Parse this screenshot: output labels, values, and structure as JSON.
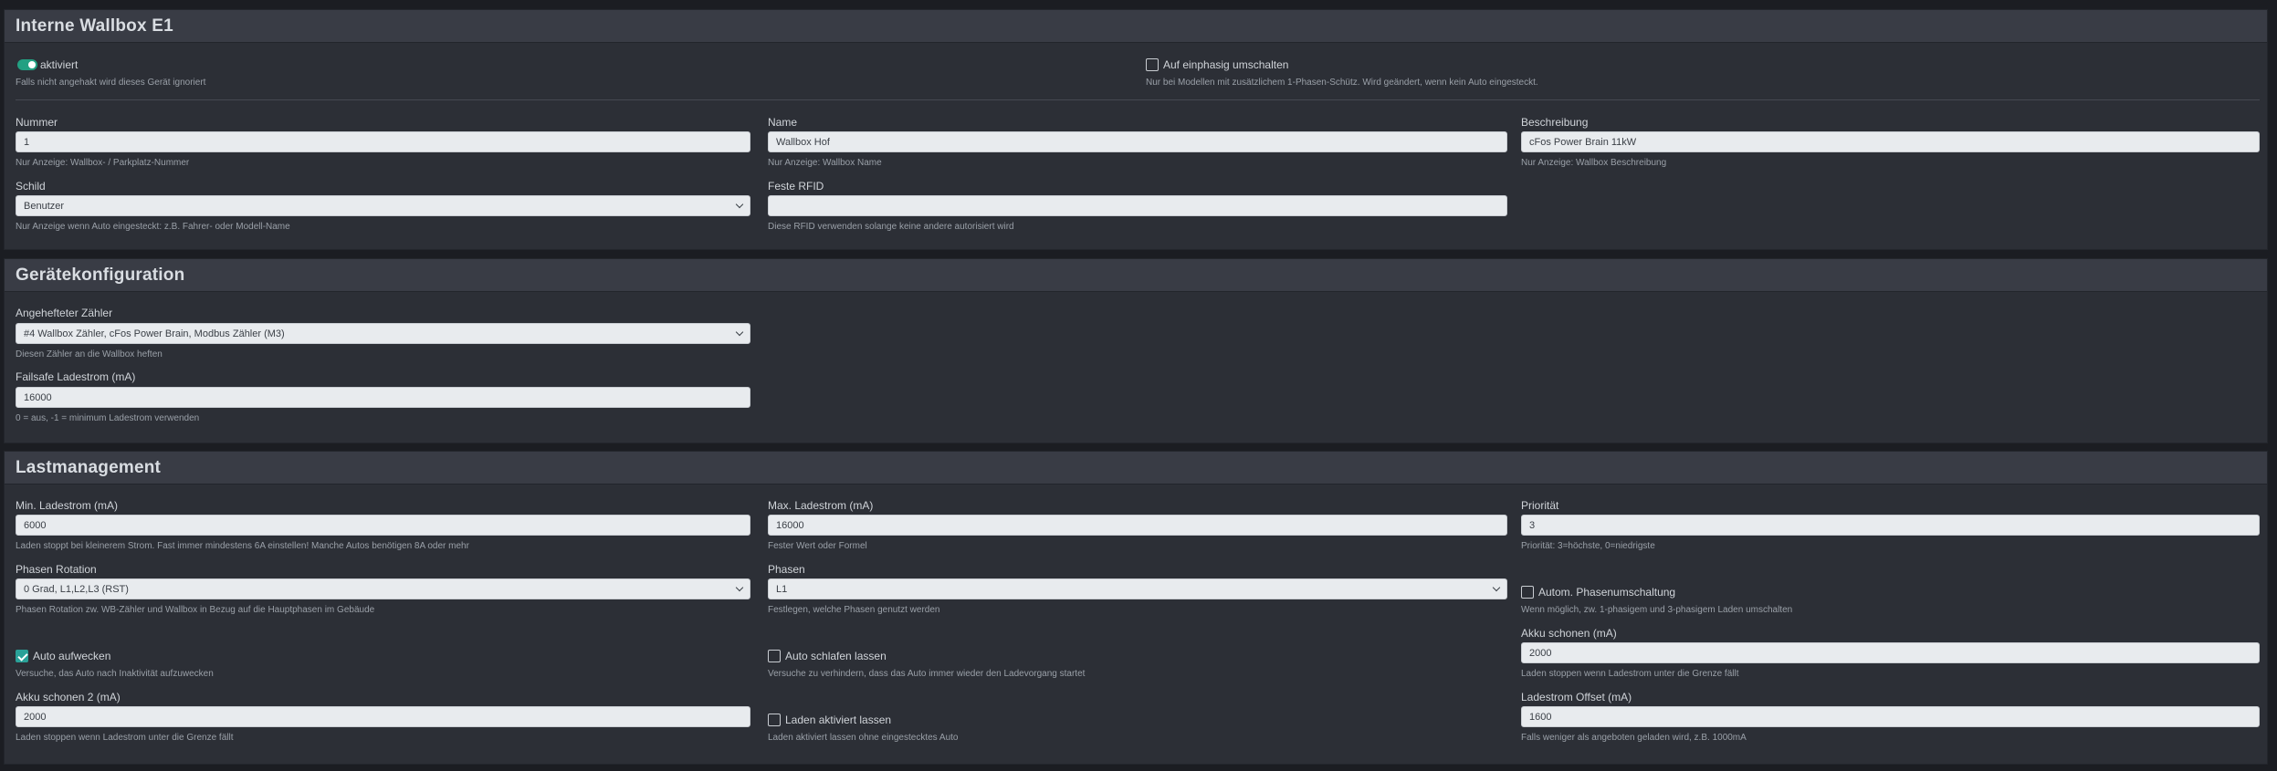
{
  "sections": {
    "wallbox": {
      "title": "Interne Wallbox E1",
      "active_label": "aktiviert",
      "active_help": "Falls nicht angehakt wird dieses Gerät ignoriert",
      "active_checked": true,
      "singlephase_label": "Auf einphasig umschalten",
      "singlephase_help": "Nur bei Modellen mit zusätzlichem 1-Phasen-Schütz. Wird geändert, wenn kein Auto eingesteckt.",
      "number": {
        "label": "Nummer",
        "value": "1",
        "help": "Nur Anzeige: Wallbox- / Parkplatz-Nummer"
      },
      "name": {
        "label": "Name",
        "value": "Wallbox Hof",
        "help": "Nur Anzeige: Wallbox Name"
      },
      "description": {
        "label": "Beschreibung",
        "value": "cFos Power Brain 11kW",
        "help": "Nur Anzeige: Wallbox Beschreibung"
      },
      "sign": {
        "label": "Schild",
        "value": "Benutzer",
        "help": "Nur Anzeige wenn Auto eingesteckt: z.B. Fahrer- oder Modell-Name"
      },
      "rfid": {
        "label": "Feste RFID",
        "value": "",
        "help": "Diese RFID verwenden solange keine andere autorisiert wird"
      }
    },
    "device": {
      "title": "Gerätekonfiguration",
      "meter": {
        "label": "Angehefteter Zähler",
        "value": "#4 Wallbox Zähler, cFos Power Brain, Modbus Zähler (M3)",
        "help": "Diesen Zähler an die Wallbox heften"
      },
      "failsafe": {
        "label": "Failsafe Ladestrom (mA)",
        "value": "16000",
        "help": "0 = aus, -1 = minimum Ladestrom verwenden"
      }
    },
    "load": {
      "title": "Lastmanagement",
      "min_current": {
        "label": "Min. Ladestrom (mA)",
        "value": "6000",
        "help": "Laden stoppt bei kleinerem Strom. Fast immer mindestens 6A einstellen! Manche Autos benötigen 8A oder mehr"
      },
      "max_current": {
        "label": "Max. Ladestrom (mA)",
        "value": "16000",
        "help": "Fester Wert oder Formel"
      },
      "priority": {
        "label": "Priorität",
        "value": "3",
        "help": "Priorität: 3=höchste, 0=niedrigste"
      },
      "phase_rotation": {
        "label": "Phasen Rotation",
        "value": "0 Grad, L1,L2,L3 (RST)",
        "help": "Phasen Rotation zw. WB-Zähler und Wallbox in Bezug auf die Hauptphasen im Gebäude"
      },
      "phases": {
        "label": "Phasen",
        "value": "L1",
        "help": "Festlegen, welche Phasen genutzt werden"
      },
      "auto_phase": {
        "label": "Autom. Phasenumschaltung",
        "checked": false,
        "help": "Wenn möglich, zw. 1-phasigem und 3-phasigem Laden umschalten"
      },
      "battery_save": {
        "label": "Akku schonen (mA)",
        "value": "2000",
        "help": "Laden stoppen wenn Ladestrom unter die Grenze fällt"
      },
      "wake_up": {
        "label": "Auto aufwecken",
        "checked": true,
        "help": "Versuche, das Auto nach Inaktivität aufzuwecken"
      },
      "let_sleep": {
        "label": "Auto schlafen lassen",
        "checked": false,
        "help": "Versuche zu verhindern, dass das Auto immer wieder den Ladevorgang startet"
      },
      "battery_save2": {
        "label": "Akku schonen 2 (mA)",
        "value": "2000",
        "help": "Laden stoppen wenn Ladestrom unter die Grenze fällt"
      },
      "keep_active": {
        "label": "Laden aktiviert lassen",
        "checked": false,
        "help": "Laden aktiviert lassen ohne eingestecktes Auto"
      },
      "offset": {
        "label": "Ladestrom Offset (mA)",
        "value": "1600",
        "help": "Falls weniger als angeboten geladen wird, z.B. 1000mA"
      }
    }
  }
}
